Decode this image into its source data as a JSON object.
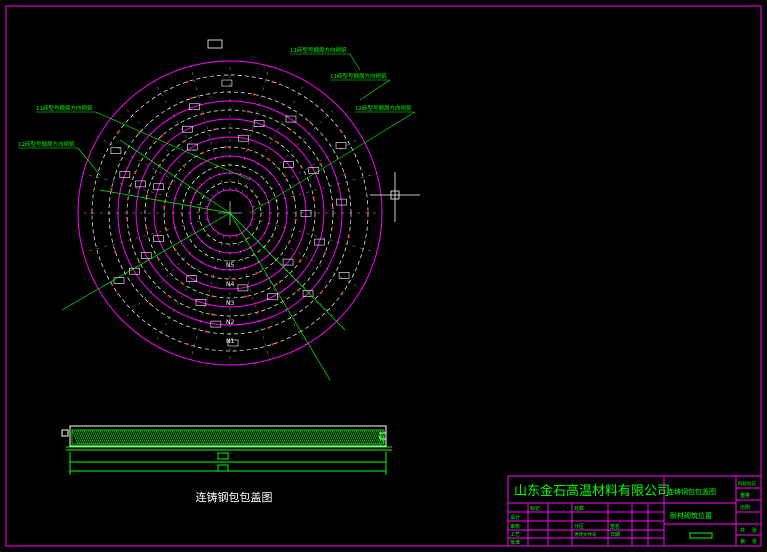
{
  "drawing": {
    "caption": "连铸钢包包盖图",
    "leaders": [
      "11砖型号顺周方向砌筑",
      "11砖型号顺周方向砌筑",
      "11砖型号顺周方向砌筑",
      "12砖型号顺周方向砌筑",
      "12砖型号顺周方向砌筑"
    ],
    "ring_marks": [
      "N1",
      "N2",
      "N3",
      "N4",
      "N5"
    ],
    "colors": {
      "background": "#000000",
      "border": "#ff00ff",
      "rings": "#ff00ff",
      "dashed_rings": "#ffffff",
      "leaders": "#00ff00",
      "text": "#00ff00",
      "accents": "#ff3030",
      "hatch": "#00ff00"
    }
  },
  "title_block": {
    "company": "山东金石高温材料有限公司",
    "drawing_name": "连铸钢包包盖图",
    "subtitle": "耐材砌筑位置",
    "rows": [
      "设计",
      "审核",
      "工艺",
      "批准"
    ],
    "cols": [
      "标记",
      "处数",
      "分区",
      "更改文件号",
      "签名",
      "日期"
    ],
    "right": [
      "阶段标记",
      "重量",
      "比例",
      "共",
      "张",
      "第",
      "张"
    ]
  }
}
